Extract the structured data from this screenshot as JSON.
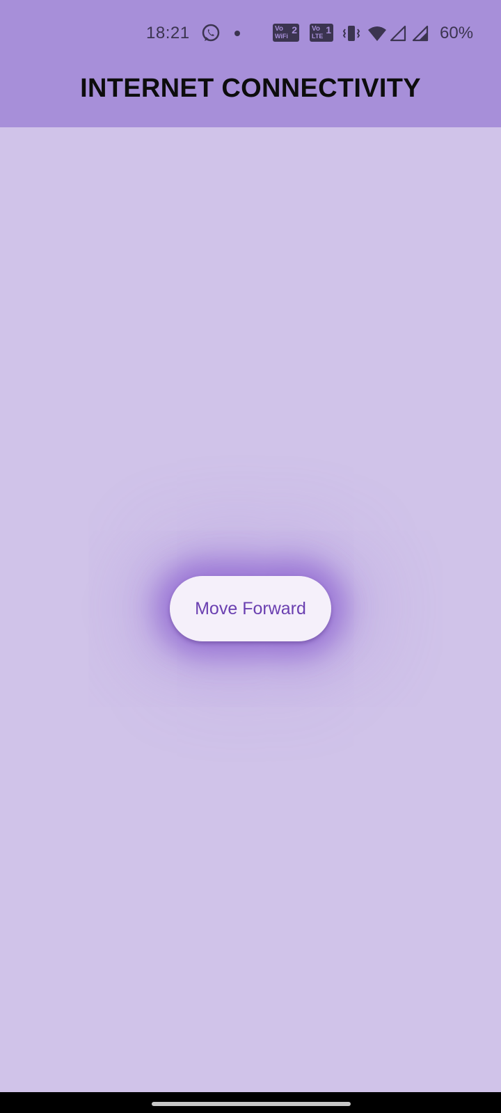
{
  "status_bar": {
    "time": "18:21",
    "wifi_calling_badge": {
      "top": "Vo",
      "bottom": "WiFi",
      "num": "2"
    },
    "lte_badge": {
      "top": "Vo",
      "bottom": "LTE",
      "num": "1"
    },
    "battery": "60%"
  },
  "app_bar": {
    "title": "INTERNET CONNECTIVITY"
  },
  "main": {
    "button_label": "Move Forward"
  },
  "colors": {
    "app_bar": "#a78fd9",
    "background": "#d0c3e9",
    "button_bg": "#f5f0fa",
    "button_text": "#6a3fb0"
  }
}
